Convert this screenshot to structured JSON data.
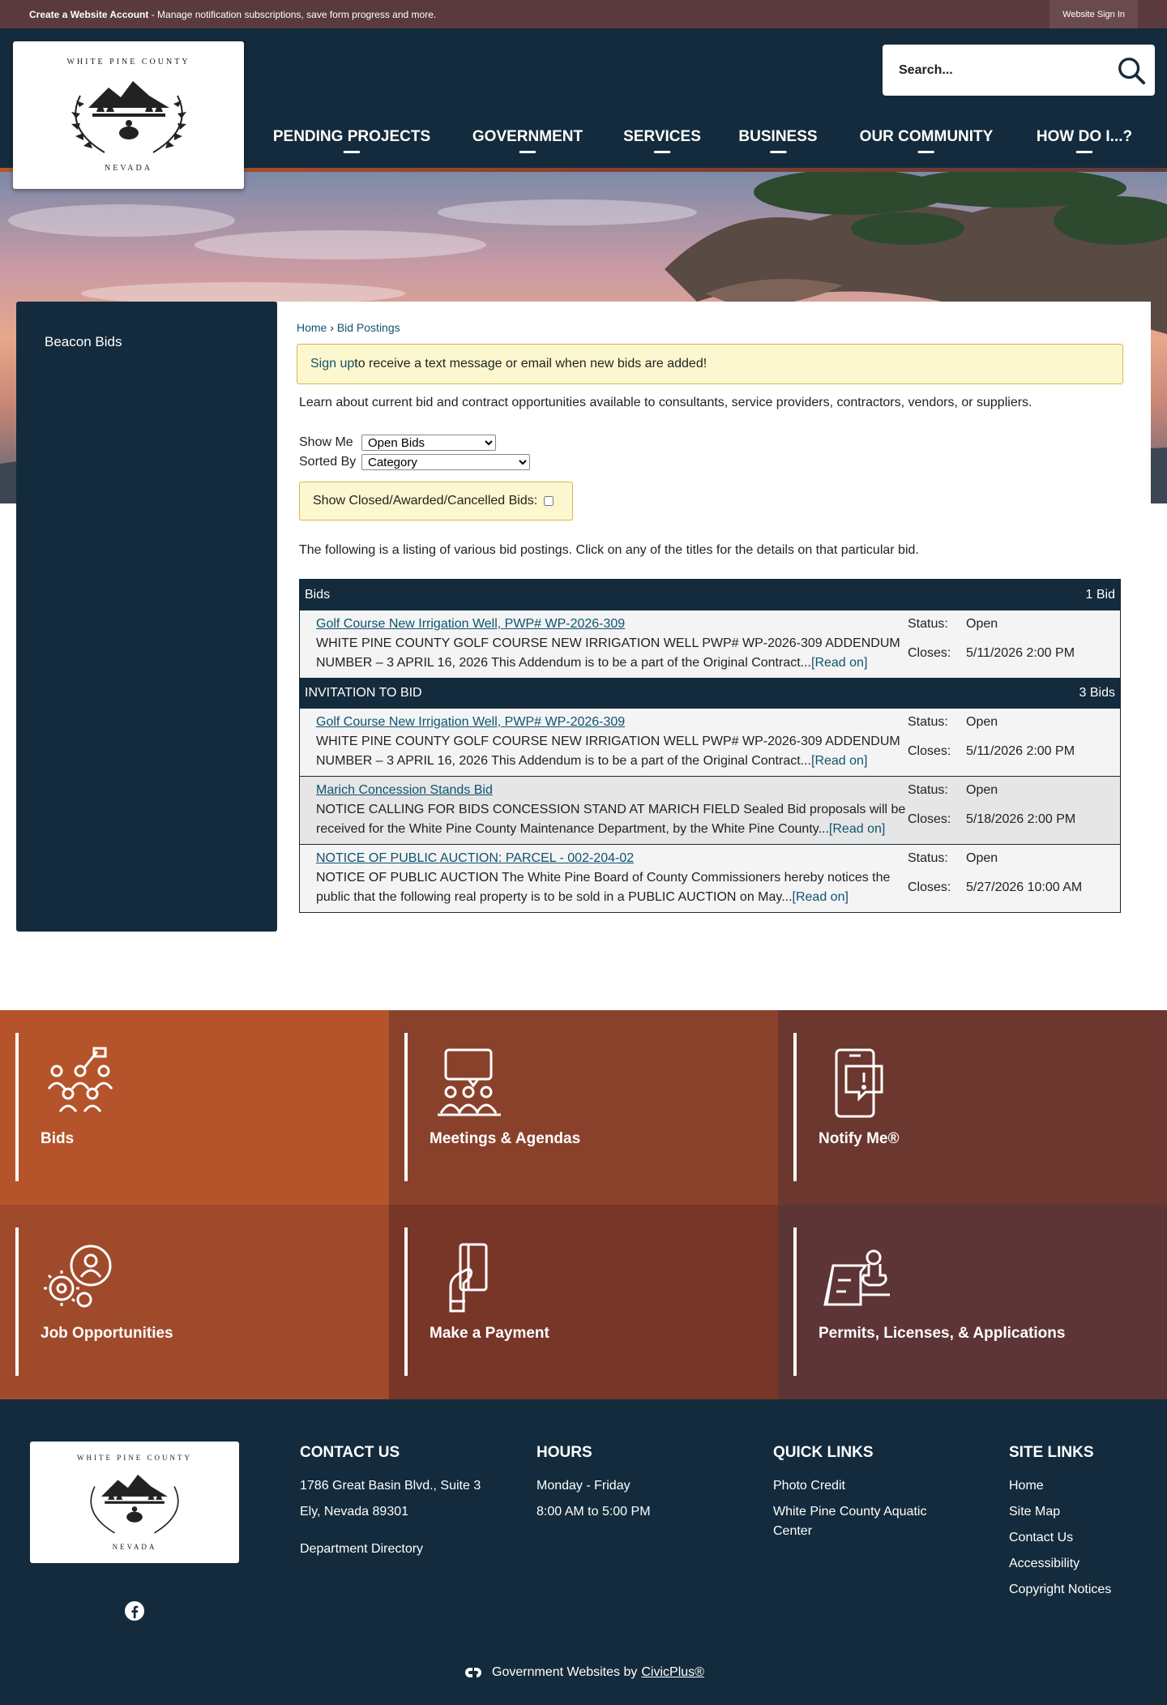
{
  "topbar": {
    "create_bold": "Create a Website Account",
    "create_rest": " - Manage notification subscriptions, save form progress and more.",
    "signin": "Website Sign In"
  },
  "logo": {
    "top": "WHITE PINE COUNTY",
    "bottom": "NEVADA"
  },
  "search": {
    "placeholder": "Search..."
  },
  "nav": [
    {
      "label": "PENDING PROJECTS"
    },
    {
      "label": "GOVERNMENT"
    },
    {
      "label": "SERVICES"
    },
    {
      "label": "BUSINESS"
    },
    {
      "label": "OUR COMMUNITY"
    },
    {
      "label": "HOW DO I...?"
    }
  ],
  "sidebar": {
    "items": [
      {
        "label": "Beacon Bids"
      }
    ]
  },
  "breadcrumb": {
    "home": "Home",
    "sep": " › ",
    "current": "Bid Postings"
  },
  "signup": {
    "link": "Sign up",
    "text": " to receive a text message or email when new bids are added!"
  },
  "intro": "Learn about current bid and contract opportunities available to consultants, service providers, contractors, vendors, or suppliers.",
  "filters": {
    "show_label": "Show Me",
    "show_value": "Open Bids",
    "sort_label": "Sorted By",
    "sort_value": "Category",
    "closed_label": "Show Closed/Awarded/Cancelled Bids:"
  },
  "listing_intro": "The following is a listing of various bid postings. Click on any of the titles for the details on that particular bid.",
  "categories": [
    {
      "name": "Bids",
      "count": "1 Bid",
      "bids": [
        {
          "title": "Golf Course New Irrigation Well, PWP# WP-2026-309",
          "desc": "WHITE PINE COUNTY GOLF COURSE NEW IRRIGATION WELL PWP# WP-2026-309 ADDENDUM NUMBER – 3 APRIL 16, 2026 This Addendum is to be a part of the Original Contract...",
          "status_label": "Status:",
          "status": "Open",
          "closes_label": "Closes:",
          "closes": "5/11/2026 2:00 PM"
        }
      ]
    },
    {
      "name": "INVITATION TO BID",
      "count": "3 Bids",
      "bids": [
        {
          "title": "Golf Course New Irrigation Well, PWP# WP-2026-309",
          "desc": "WHITE PINE COUNTY GOLF COURSE NEW IRRIGATION WELL PWP# WP-2026-309 ADDENDUM NUMBER – 3 APRIL 16, 2026 This Addendum is to be a part of the Original Contract...",
          "status_label": "Status:",
          "status": "Open",
          "closes_label": "Closes:",
          "closes": "5/11/2026 2:00 PM"
        },
        {
          "title": "Marich Concession Stands Bid",
          "desc": "NOTICE CALLING FOR BIDS CONCESSION STAND AT MARICH FIELD Sealed Bid proposals will be received for the White Pine County Maintenance Department, by the White Pine County...",
          "status_label": "Status:",
          "status": "Open",
          "closes_label": "Closes:",
          "closes": "5/18/2026 2:00 PM"
        },
        {
          "title": "NOTICE OF PUBLIC AUCTION: PARCEL - 002-204-02",
          "desc": "NOTICE OF PUBLIC AUCTION The White Pine Board of County Commissioners hereby notices the public that the following real property is to be sold in a PUBLIC AUCTION on May...",
          "status_label": "Status:",
          "status": "Open",
          "closes_label": "Closes:",
          "closes": "5/27/2026 10:00 AM"
        }
      ]
    }
  ],
  "read_on": "[Read on]",
  "tiles": [
    {
      "label": "Bids",
      "icon": "bids-icon",
      "color": "#b5542a"
    },
    {
      "label": "Meetings & Agendas",
      "icon": "meetings-icon",
      "color": "#8a412c"
    },
    {
      "label": "Notify Me®",
      "icon": "notify-phone-icon",
      "color": "#6b372e"
    },
    {
      "label": "Job Opportunities",
      "icon": "job-gears-icon",
      "color": "#a04a2c"
    },
    {
      "label": "Make a Payment",
      "icon": "payment-card-icon",
      "color": "#783628"
    },
    {
      "label": "Permits, Licenses, & Applications",
      "icon": "permit-stamp-icon",
      "color": "#5e3536"
    }
  ],
  "footer": {
    "contact": {
      "title": "CONTACT US",
      "line1": "1786 Great Basin Blvd., Suite 3",
      "line2": "Ely, Nevada 89301",
      "link": "Department Directory"
    },
    "hours": {
      "title": "HOURS",
      "line1": "Monday - Friday",
      "line2": "8:00 AM to 5:00 PM"
    },
    "quick": {
      "title": "QUICK LINKS",
      "items": [
        "Photo Credit",
        "White Pine County Aquatic Center"
      ]
    },
    "site": {
      "title": "SITE LINKS",
      "items": [
        "Home",
        "Site Map",
        "Contact Us",
        "Accessibility",
        "Copyright Notices"
      ]
    },
    "credit_text": "Government Websites by",
    "credit_link": "CivicPlus®"
  },
  "colors": {
    "navy": "#132b3c",
    "topbar": "#5a3a3c",
    "link": "#0e5470",
    "notice_bg": "#fdf7cf",
    "notice_border": "#d7b651"
  }
}
